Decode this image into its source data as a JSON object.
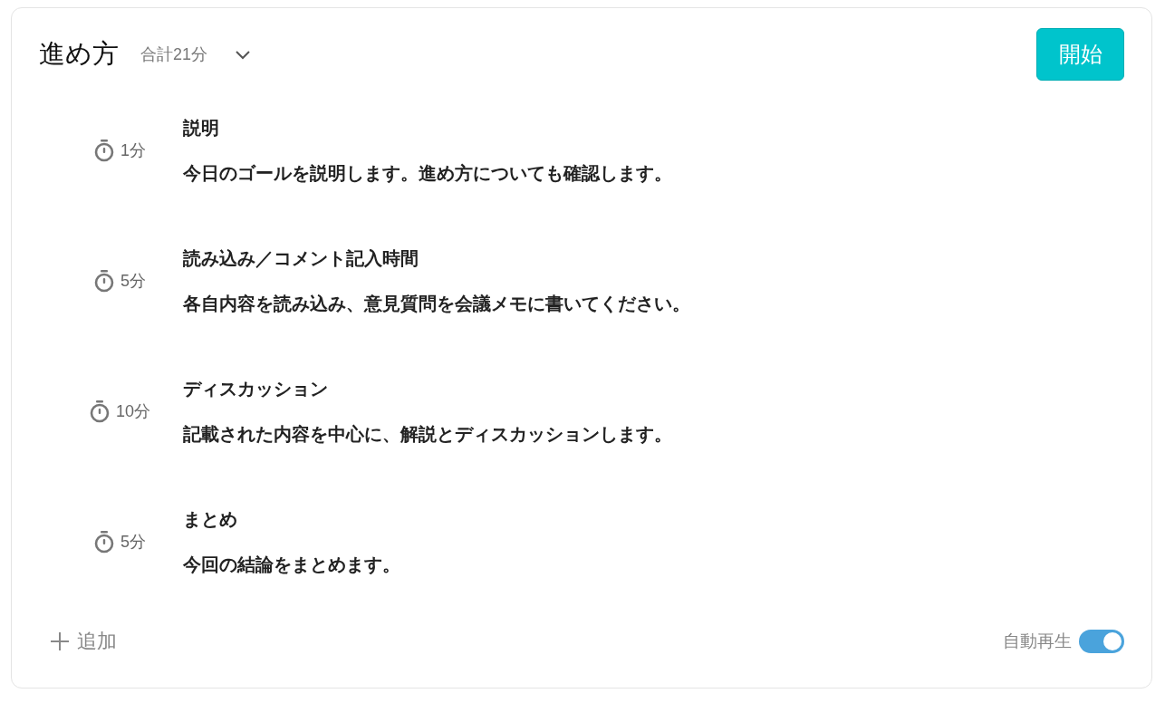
{
  "header": {
    "title": "進め方",
    "total": "合計21分",
    "expanded": true,
    "start_button": "開始"
  },
  "steps": [
    {
      "duration": "1分",
      "title": "説明",
      "description": "今日のゴールを説明します。進め方についても確認します。"
    },
    {
      "duration": "5分",
      "title": "読み込み／コメント記入時間",
      "description": "各自内容を読み込み、意見質問を会議メモに書いてください。"
    },
    {
      "duration": "10分",
      "title": "ディスカッション",
      "description": "記載された内容を中心に、解説とディスカッションします。"
    },
    {
      "duration": "5分",
      "title": "まとめ",
      "description": "今回の結論をまとめます。"
    }
  ],
  "footer": {
    "add_label": "追加",
    "autoplay_label": "自動再生",
    "autoplay_on": true
  }
}
